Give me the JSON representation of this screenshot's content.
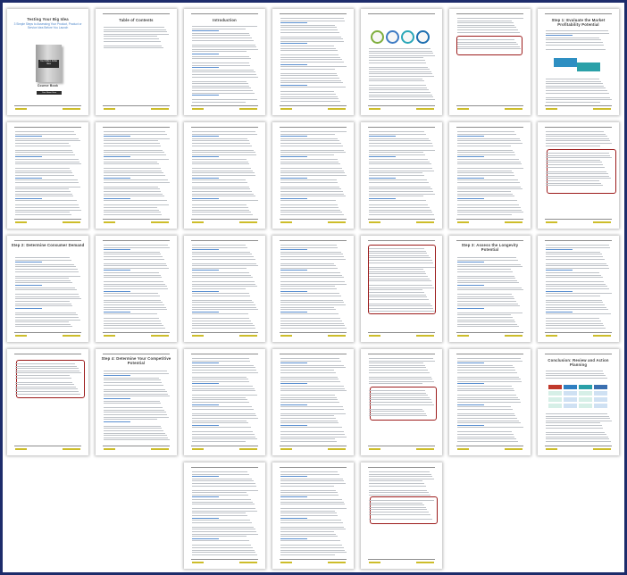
{
  "cover": {
    "title": "Testing Your Big Idea",
    "subtitle": "3 Simple Steps to Assessing Your Product, Product or Service Idea Before You Launch",
    "book_label": "Your Million Dollar Idea",
    "course_label": "Course Book",
    "button_label": "Your Name Here"
  },
  "toc": {
    "title": "Table of Contents"
  },
  "intro": {
    "title": "Introduction"
  },
  "steps": {
    "step1": "Step 1: Evaluate the Market Profitability Potential",
    "step2": "Step 2: Determine Consumer Demand",
    "step3": "Step 3: Assess the Longevity Potential",
    "step4": "Step 4: Determine Your Competitive Potential",
    "conclusion": "Conclusion: Review and Action Planning"
  },
  "colors": {
    "frame": "#1d2c6b",
    "highlight": "#9c1c1c",
    "accent_blue": "#4a84c8",
    "footer_yellow": "#cdbd2a"
  },
  "icons": {
    "cycle_diagram": "four-circle-cycle",
    "arrow_diagram": "double-arrow",
    "grid_diagram": "color-grid"
  }
}
